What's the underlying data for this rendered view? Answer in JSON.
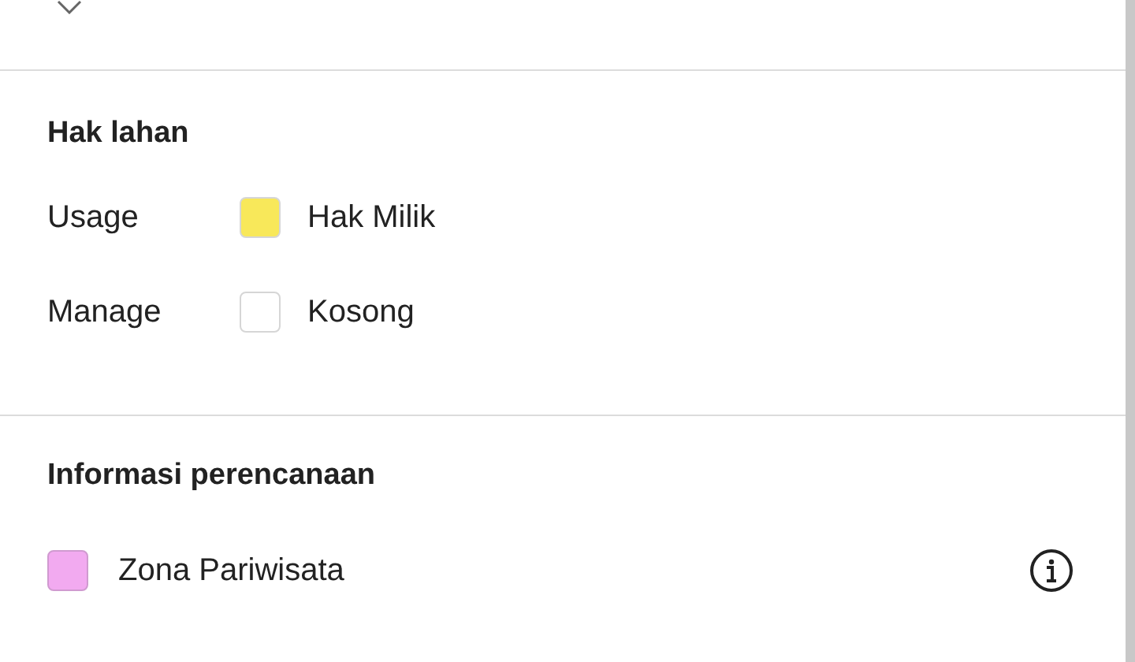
{
  "land_rights": {
    "title": "Hak lahan",
    "rows": [
      {
        "label": "Usage",
        "value": "Hak Milik",
        "color": "#f8e85a"
      },
      {
        "label": "Manage",
        "value": "Kosong",
        "color": "#ffffff"
      }
    ]
  },
  "planning": {
    "title": "Informasi perencanaan",
    "zones": [
      {
        "label": "Zona Pariwisata",
        "color": "#f2aaf0"
      }
    ]
  }
}
